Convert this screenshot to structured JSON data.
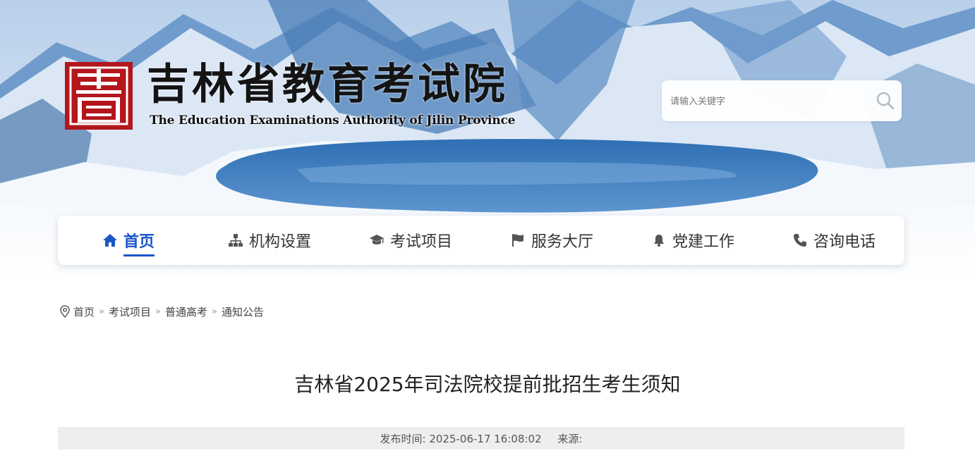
{
  "site": {
    "title": "吉林省教育考试院",
    "subtitle": "The Education Examinations Authority of Jilin Province",
    "logo_icon": "seal-logo-icon"
  },
  "search": {
    "placeholder": "请输入关键字",
    "icon": "search-icon"
  },
  "nav": {
    "items": [
      {
        "label": "首页",
        "icon": "home-icon",
        "active": true
      },
      {
        "label": "机构设置",
        "icon": "org-chart-icon",
        "active": false
      },
      {
        "label": "考试项目",
        "icon": "graduation-cap-icon",
        "active": false
      },
      {
        "label": "服务大厅",
        "icon": "flag-icon",
        "active": false
      },
      {
        "label": "党建工作",
        "icon": "bell-icon",
        "active": false
      },
      {
        "label": "咨询电话",
        "icon": "phone-icon",
        "active": false
      }
    ]
  },
  "breadcrumb": {
    "icon": "location-pin-icon",
    "items": [
      "首页",
      "考试项目",
      "普通高考",
      "通知公告"
    ],
    "separator": "»"
  },
  "article": {
    "title": "吉林省2025年司法院校提前批招生考生须知",
    "publish_label": "发布时间: 2025-06-17 16:08:02",
    "source_label": "来源:"
  },
  "colors": {
    "accent": "#1a56c8",
    "logo_red": "#b3161b",
    "meta_bg": "#eeeeee"
  }
}
